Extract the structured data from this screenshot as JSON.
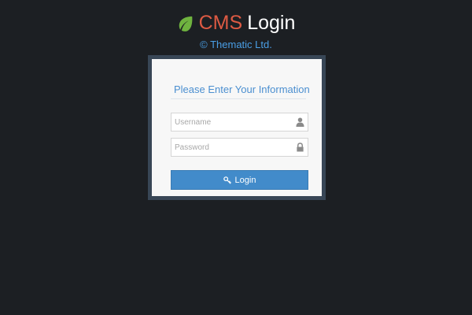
{
  "header": {
    "title_cms": "CMS",
    "title_login": "Login",
    "copyright": "© Thematic Ltd.",
    "logo_icon": "leaf-icon",
    "colors": {
      "cms": "#dd5a43",
      "login": "#ffffff",
      "copyright": "#4a9fe6",
      "leaf": "#6fb33f"
    }
  },
  "login_box": {
    "heading": "Please Enter Your Information",
    "heading_icon": "coffee-cup-icon",
    "username": {
      "placeholder": "Username",
      "value": "",
      "icon": "user-icon"
    },
    "password": {
      "placeholder": "Password",
      "value": "",
      "icon": "lock-icon"
    },
    "submit": {
      "label": "Login",
      "icon": "key-icon",
      "color": "#428bca"
    }
  }
}
